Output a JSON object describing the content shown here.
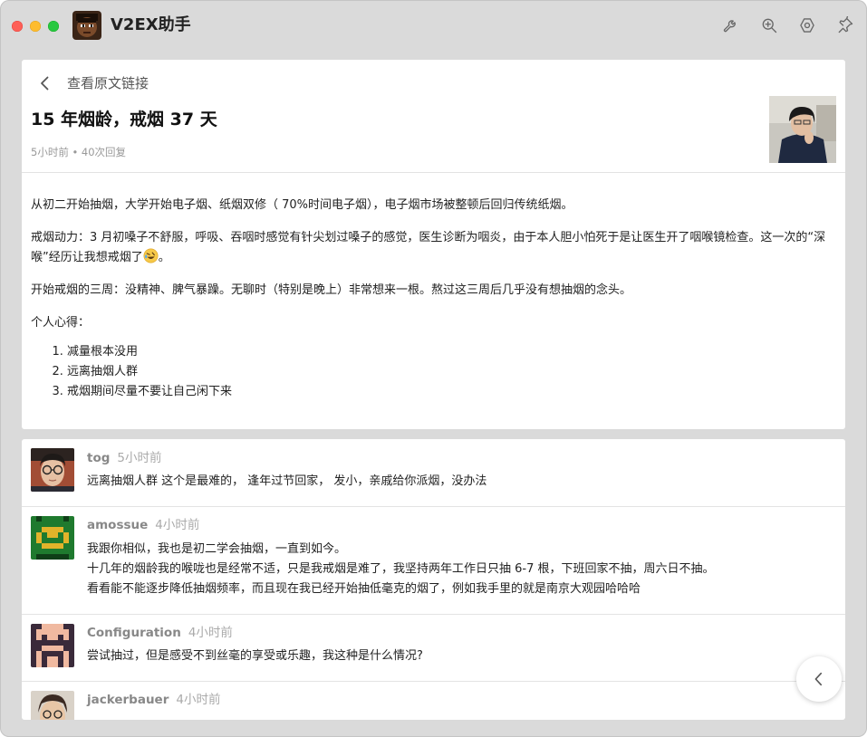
{
  "window": {
    "app_title": "V2EX助手",
    "toolbar_icons": [
      "wrench-icon",
      "zoom-in-icon",
      "settings-icon",
      "pin-icon"
    ]
  },
  "article": {
    "back_label": "查看原文链接",
    "title": "15 年烟龄，戒烟 37 天",
    "meta": "5小时前 • 40次回复",
    "paragraphs": [
      "从初二开始抽烟，大学开始电子烟、纸烟双修（ 70%时间电子烟），电子烟市场被整顿后回归传统纸烟。",
      "戒烟动力：3 月初嗓子不舒服，呼吸、吞咽时感觉有针尖划过嗓子的感觉，医生诊断为咽炎，由于本人胆小怕死于是让医生开了咽喉镜检查。这一次的“深喉”经历让我想戒烟了",
      "开始戒烟的三周：没精神、脾气暴躁。无聊时（特别是晚上）非常想来一根。熬过这三周后几乎没有想抽烟的念头。",
      "个人心得："
    ],
    "list": [
      "减量根本没用",
      "远离抽烟人群",
      "戒烟期间尽量不要让自己闲下来"
    ]
  },
  "replies": [
    {
      "user": "tog",
      "time": "5小时前",
      "lines": [
        "远离抽烟人群 这个是最难的， 逢年过节回家， 发小，亲戚给你派烟，没办法"
      ]
    },
    {
      "user": "amossue",
      "time": "4小时前",
      "lines": [
        "我跟你相似，我也是初二学会抽烟，一直到如今。",
        "十几年的烟龄我的喉咙也是经常不适，只是我戒烟是难了，我坚持两年工作日只抽 6-7 根，下班回家不抽，周六日不抽。",
        "看看能不能逐步降低抽烟频率，而且现在我已经开始抽低毫克的烟了，例如我手里的就是南京大观园哈哈哈"
      ]
    },
    {
      "user": "Configuration",
      "time": "4小时前",
      "lines": [
        "尝试抽过，但是感受不到丝毫的享受或乐趣，我这种是什么情况?"
      ]
    },
    {
      "user": "jackerbauer",
      "time": "4小时前",
      "lines": []
    }
  ],
  "colors": {
    "window_bg": "#dadada",
    "card_bg": "#ffffff",
    "title_text": "#111111",
    "meta_text": "#999999",
    "username_text": "#888888"
  }
}
